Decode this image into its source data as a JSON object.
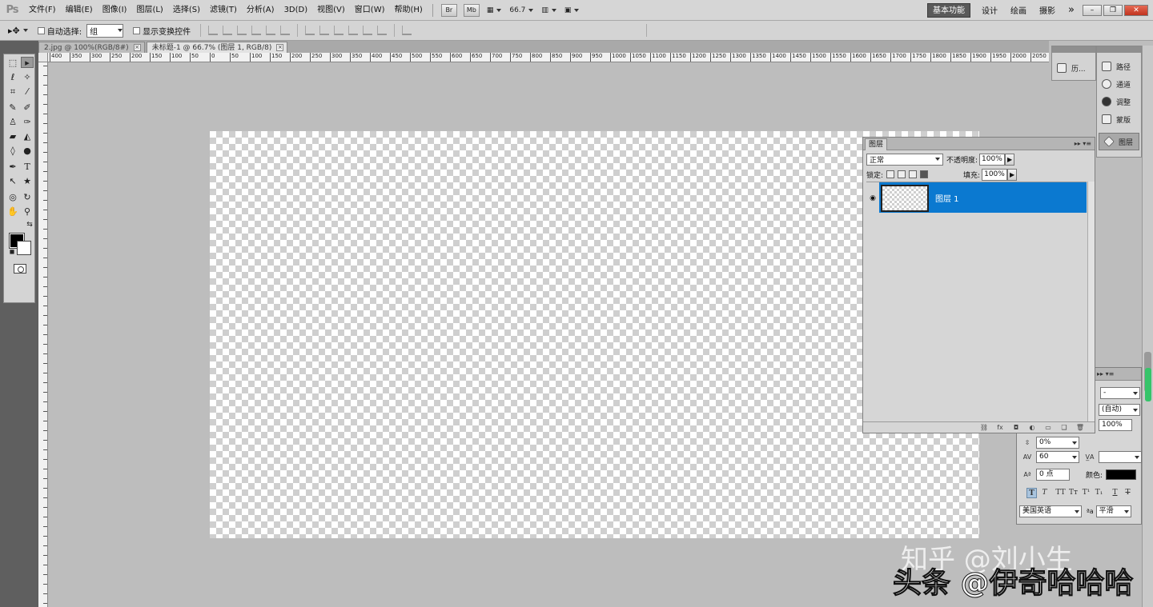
{
  "app": {
    "logo": "Ps"
  },
  "menu": [
    "文件(F)",
    "编辑(E)",
    "图像(I)",
    "图层(L)",
    "选择(S)",
    "滤镜(T)",
    "分析(A)",
    "3D(D)",
    "视图(V)",
    "窗口(W)",
    "帮助(H)"
  ],
  "menubar_right": {
    "bridge": "Br",
    "minibridge": "Mb",
    "zoom": "66.7",
    "workspaces": [
      "基本功能",
      "设计",
      "绘画",
      "摄影"
    ],
    "more": "»"
  },
  "options": {
    "auto_select_label": "自动选择:",
    "auto_select_value": "组",
    "show_transform_label": "显示变换控件"
  },
  "tabs": [
    {
      "label": "2.jpg @ 100%(RGB/8#)"
    },
    {
      "label": "未标题-1 @ 66.7% (图层 1, RGB/8)"
    }
  ],
  "ruler": [
    "400",
    "350",
    "300",
    "250",
    "200",
    "150",
    "100",
    "50",
    "0",
    "50",
    "100",
    "150",
    "200",
    "250",
    "300",
    "350",
    "400",
    "450",
    "500",
    "550",
    "600",
    "650",
    "700",
    "750",
    "800",
    "850",
    "900",
    "950",
    "1000",
    "1050",
    "1100",
    "1150",
    "1200",
    "1250",
    "1300",
    "1350",
    "1400",
    "1450",
    "1500",
    "1550",
    "1600",
    "1650",
    "1700",
    "1750",
    "1800",
    "1850",
    "1900",
    "1950",
    "2000",
    "2050"
  ],
  "dock": {
    "history": "历...",
    "items": [
      "路径",
      "通道",
      "调整",
      "蒙版",
      "图层"
    ]
  },
  "layers_panel": {
    "title": "图层",
    "blend_mode": "正常",
    "opacity_label": "不透明度:",
    "opacity": "100%",
    "lock_label": "锁定:",
    "fill_label": "填充:",
    "fill": "100%",
    "layers": [
      {
        "name": "图层 1"
      }
    ]
  },
  "char_panel": {
    "font_style": "-",
    "leading": "(自动)",
    "vscale": "100%",
    "tsume": "0%",
    "tracking": "60",
    "baseline": "0 点",
    "color_label": "颜色:",
    "language": "美国英语",
    "antialias": "平滑",
    "aa_prefix": "ªa"
  },
  "watermark": {
    "line1": "知乎 @刘小生",
    "line2": "头条 @伊奇哈哈哈"
  },
  "colors": {
    "selection": "#0b79d0",
    "fg": "#000000",
    "bg": "#ffffff"
  }
}
